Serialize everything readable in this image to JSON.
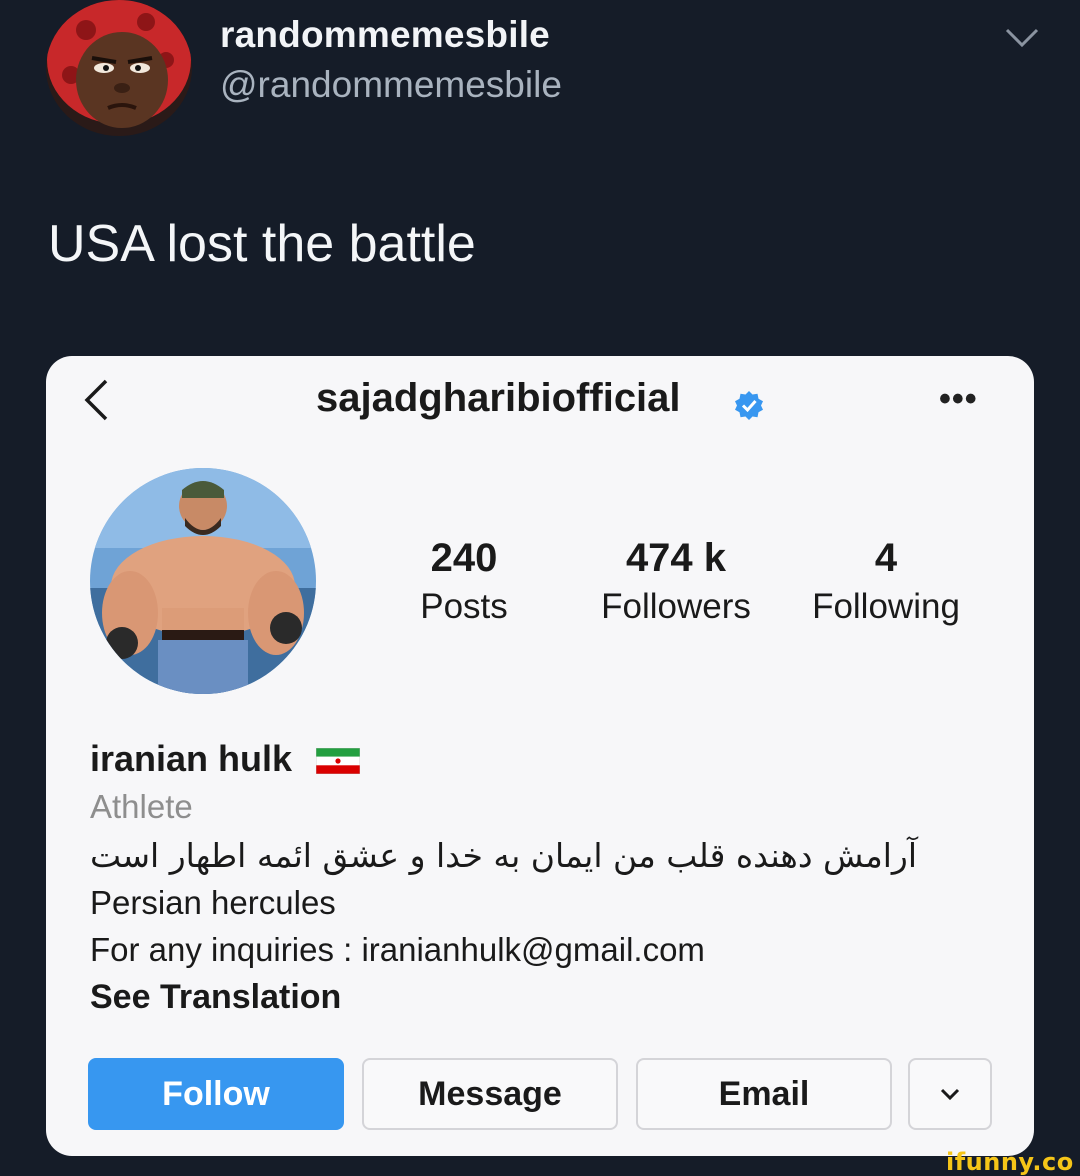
{
  "tweet": {
    "display_name": "randommemesbile",
    "handle": "@randommemesbile",
    "text": "USA lost the battle"
  },
  "instagram": {
    "username": "sajadgharibiofficial",
    "verified": true,
    "more_label": "•••",
    "stats": [
      {
        "value": "240",
        "label": "Posts"
      },
      {
        "value": "474 k",
        "label": "Followers"
      },
      {
        "value": "4",
        "label": "Following"
      }
    ],
    "full_name": "iranian hulk",
    "category": "Athlete",
    "bio_persian": "آرامش دهنده قلب من ایمان به خدا و عشق ائمه اطهار است",
    "bio_line1": "Persian hercules",
    "bio_line2": "For any inquiries : iranianhulk@gmail.com",
    "see_translation": "See Translation",
    "buttons": {
      "follow": "Follow",
      "message": "Message",
      "email": "Email"
    }
  },
  "watermark": "ifunny.co",
  "colors": {
    "background": "#151c28",
    "card": "#f7f7f9",
    "follow_button": "#3797f0",
    "verified_badge": "#3897f0"
  }
}
